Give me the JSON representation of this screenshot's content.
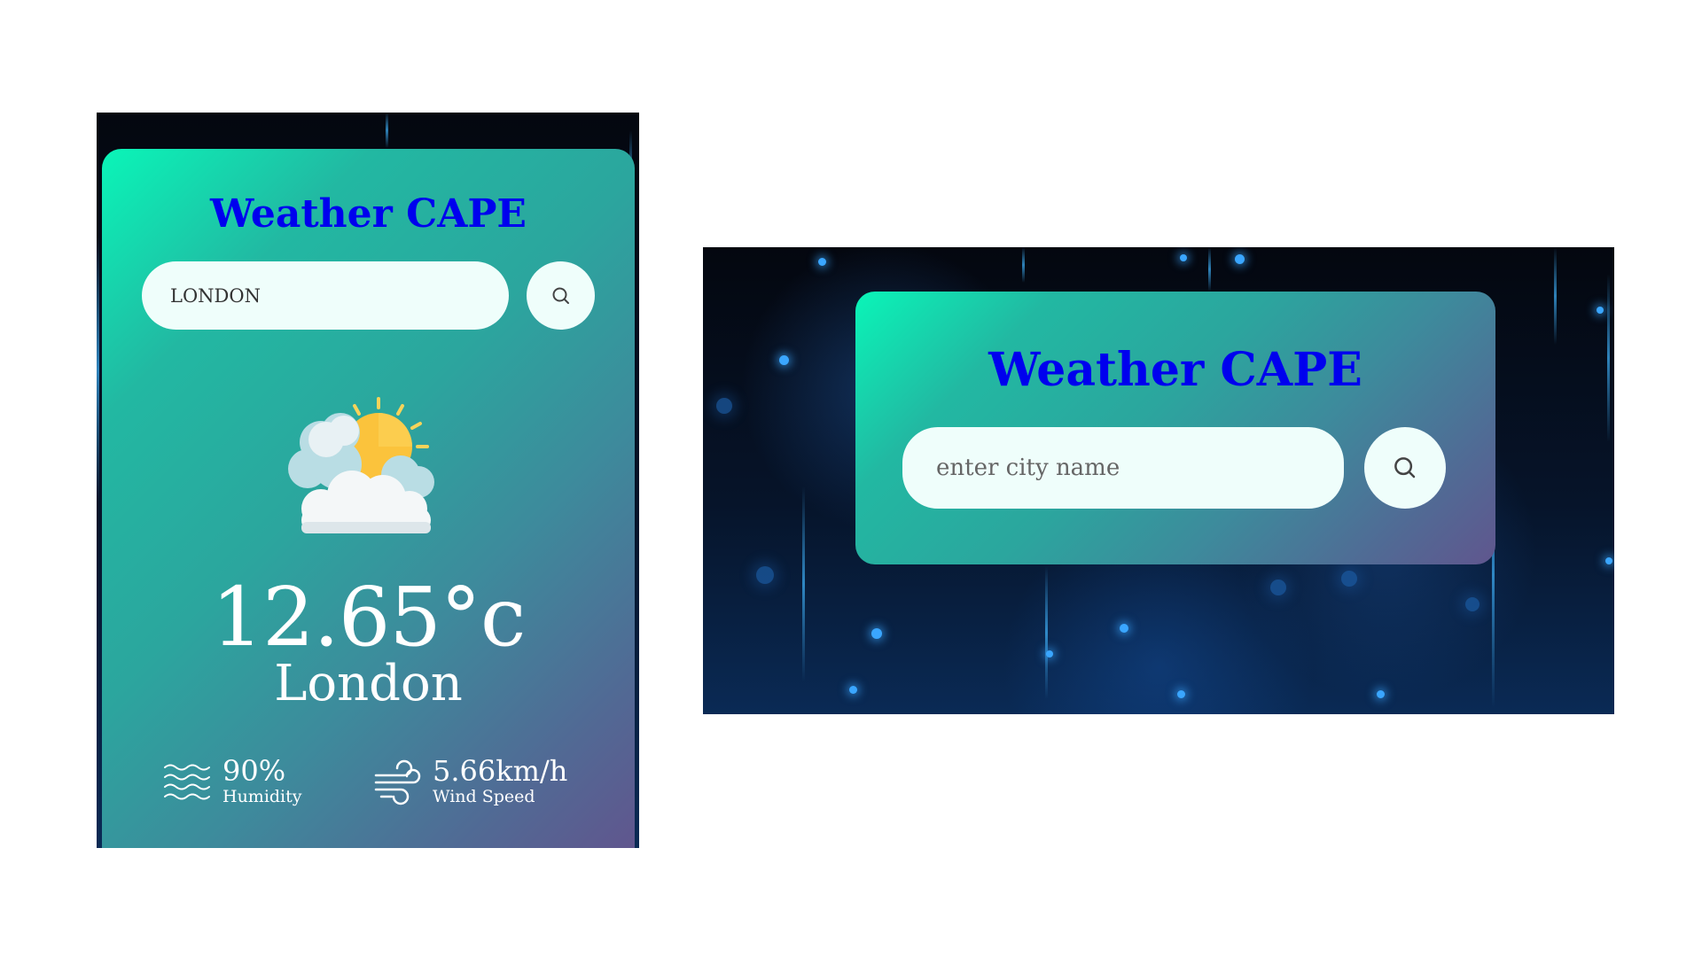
{
  "left_view": {
    "title": "Weather CAPE",
    "search": {
      "value": "LONDON",
      "placeholder": "enter city name"
    },
    "weather_icon": "partly-cloudy-icon",
    "temperature": "12.65°c",
    "city": "London",
    "humidity": {
      "value": "90%",
      "label": "Humidity",
      "icon": "humidity-waves-icon"
    },
    "wind": {
      "value": "5.66km/h",
      "label": "Wind Speed",
      "icon": "wind-icon"
    }
  },
  "right_view": {
    "title": "Weather CAPE",
    "search": {
      "value": "",
      "placeholder": "enter city name"
    }
  },
  "colors": {
    "title": "#0000ee",
    "card_gradient_start": "#0af5b8",
    "card_gradient_end": "#60568e",
    "input_bg": "#effefb",
    "text_light": "#ffffff"
  }
}
